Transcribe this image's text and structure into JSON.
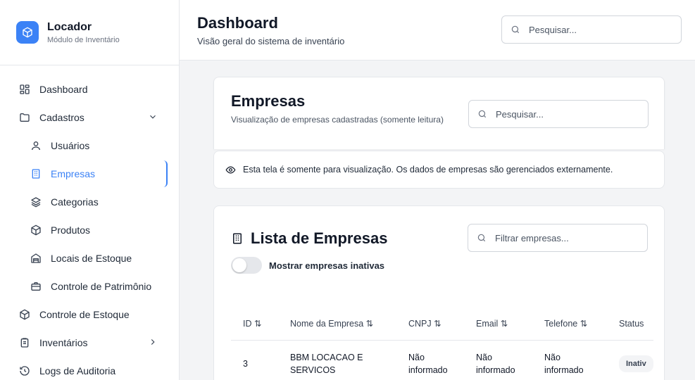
{
  "app": {
    "name": "Locador",
    "module": "Módulo de Inventário"
  },
  "sidebar": {
    "items": [
      {
        "label": "Dashboard",
        "icon": "grid-icon"
      },
      {
        "label": "Cadastros",
        "icon": "folder-icon"
      },
      {
        "label": "Usuários",
        "icon": "user-icon"
      },
      {
        "label": "Empresas",
        "icon": "building-icon"
      },
      {
        "label": "Categorias",
        "icon": "layers-icon"
      },
      {
        "label": "Produtos",
        "icon": "box-icon"
      },
      {
        "label": "Locais de Estoque",
        "icon": "warehouse-icon"
      },
      {
        "label": "Controle de Patrimônio",
        "icon": "briefcase-icon"
      },
      {
        "label": "Controle de Estoque",
        "icon": "package-icon"
      },
      {
        "label": "Inventários",
        "icon": "clipboard-icon"
      },
      {
        "label": "Logs de Auditoria",
        "icon": "history-icon"
      }
    ]
  },
  "header": {
    "title": "Dashboard",
    "subtitle": "Visão geral do sistema de inventário",
    "search_placeholder": "Pesquisar..."
  },
  "empresas_card": {
    "title": "Empresas",
    "description": "Visualização de empresas cadastradas (somente leitura)",
    "search_placeholder": "Pesquisar..."
  },
  "info_banner": {
    "text": "Esta tela é somente para visualização. Os dados de empresas são gerenciados externamente."
  },
  "list_card": {
    "title": "Lista de Empresas",
    "filter_placeholder": "Filtrar empresas...",
    "toggle_label": "Mostrar empresas inativas",
    "toggle_on": false
  },
  "table": {
    "columns": [
      "ID ⇅",
      "Nome da Empresa ⇅",
      "CNPJ ⇅",
      "Email ⇅",
      "Telefone ⇅",
      "Status"
    ],
    "rows": [
      {
        "id": "3",
        "nome": "BBM LOCACAO E SERVICOS",
        "cnpj": "Não informado",
        "email": "Não informado",
        "telefone": "Não informado",
        "status": "Inativ"
      }
    ]
  },
  "colors": {
    "accent": "#3b82f6",
    "border": "#e5e7eb",
    "background": "#f3f4f6"
  }
}
